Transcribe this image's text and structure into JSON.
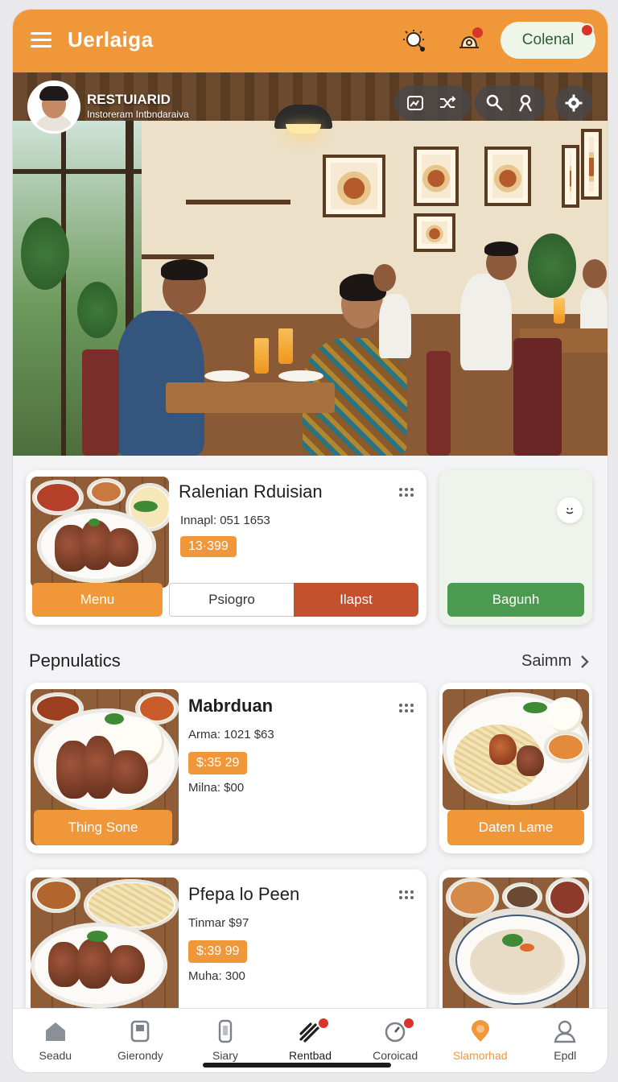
{
  "header": {
    "title": "Uerlaiga",
    "icons": [
      "sun-search-icon",
      "bell-icon"
    ],
    "pill_button": "Colenal",
    "accent": "#f0973a"
  },
  "hero": {
    "restaurant_name": "RESTUIARID",
    "restaurant_sub": "Instoreram Intbndaraiva",
    "tools": [
      "image-icon",
      "shuffle-icon",
      "search-icon",
      "user-icon",
      "gear-icon"
    ]
  },
  "featured": {
    "title": "Ralenian Rduisian",
    "meta": "Innapl: 051 1653",
    "price": "13·399",
    "buttons": {
      "menu": "Menu",
      "secondary": "Psiogro",
      "primary": "Ilapst"
    },
    "side_button": "Bagunh"
  },
  "section": {
    "title": "Pepnulatics",
    "see_all": "Saimm"
  },
  "items": [
    {
      "title": "Mabrduan",
      "meta1": "Arma: 1021 $63",
      "price": "$:35 29",
      "meta2": "Milna: $00",
      "button": "Thing Sone",
      "side_button": "Daten Lame"
    },
    {
      "title": "Pfepa lo Peen",
      "meta1": "Tinmar $97",
      "price": "$:39 99",
      "meta2": "Muha: 300"
    }
  ],
  "bottom_nav": [
    {
      "label": "Seadu",
      "icon": "home-icon"
    },
    {
      "label": "Gierondy",
      "icon": "save-icon"
    },
    {
      "label": "Siary",
      "icon": "phone-icon"
    },
    {
      "label": "Rentbad",
      "icon": "utensils-icon",
      "badge": true
    },
    {
      "label": "Coroicad",
      "icon": "clock-icon",
      "badge": true
    },
    {
      "label": "Slamorhad",
      "icon": "location-icon",
      "active": true
    },
    {
      "label": "Epdl",
      "icon": "profile-icon"
    }
  ]
}
